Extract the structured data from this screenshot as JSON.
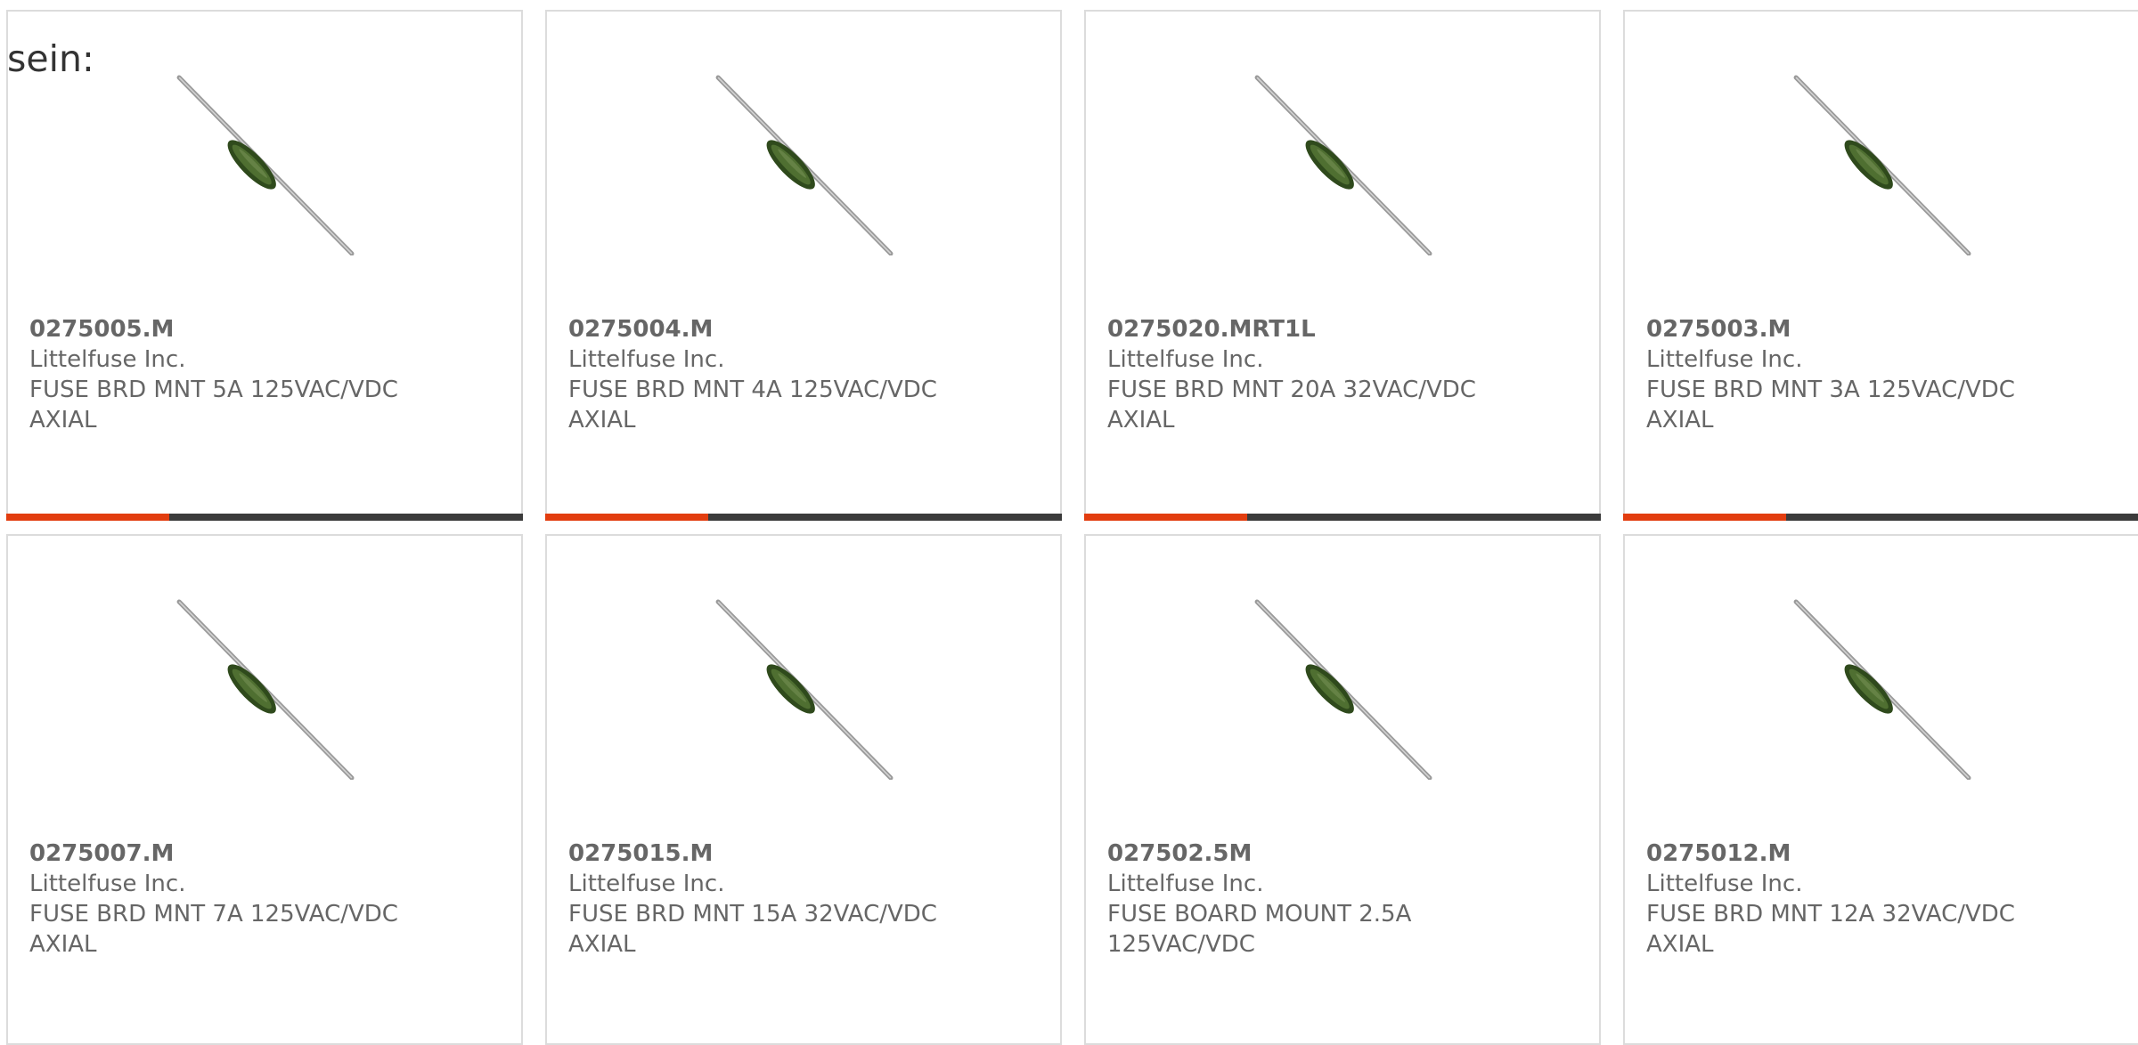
{
  "intro_text": "sein:",
  "colors": {
    "accent": "#e23d0f",
    "bar_dark": "#3b3b3b",
    "card_border": "#dcdcdc",
    "text": "#666666"
  },
  "products": [
    {
      "part_number": "0275005.M",
      "manufacturer": "Littelfuse Inc.",
      "description": "FUSE BRD MNT 5A 125VAC/VDC AXIAL",
      "image": "axial-fuse-icon"
    },
    {
      "part_number": "0275004.M",
      "manufacturer": "Littelfuse Inc.",
      "description": "FUSE BRD MNT 4A 125VAC/VDC AXIAL",
      "image": "axial-fuse-icon"
    },
    {
      "part_number": "0275020.MRT1L",
      "manufacturer": "Littelfuse Inc.",
      "description": "FUSE BRD MNT 20A 32VAC/VDC AXIAL",
      "image": "axial-fuse-icon"
    },
    {
      "part_number": "0275003.M",
      "manufacturer": "Littelfuse Inc.",
      "description": "FUSE BRD MNT 3A 125VAC/VDC AXIAL",
      "image": "axial-fuse-icon"
    },
    {
      "part_number": "0275007.M",
      "manufacturer": "Littelfuse Inc.",
      "description": "FUSE BRD MNT 7A 125VAC/VDC AXIAL",
      "image": "axial-fuse-icon"
    },
    {
      "part_number": "0275015.M",
      "manufacturer": "Littelfuse Inc.",
      "description": "FUSE BRD MNT 15A 32VAC/VDC AXIAL",
      "image": "axial-fuse-icon"
    },
    {
      "part_number": "027502.5M",
      "manufacturer": "Littelfuse Inc.",
      "description": "FUSE BOARD MOUNT 2.5A 125VAC/VDC",
      "image": "axial-fuse-icon"
    },
    {
      "part_number": "0275012.M",
      "manufacturer": "Littelfuse Inc.",
      "description": "FUSE BRD MNT 12A 32VAC/VDC AXIAL",
      "image": "axial-fuse-icon"
    }
  ]
}
